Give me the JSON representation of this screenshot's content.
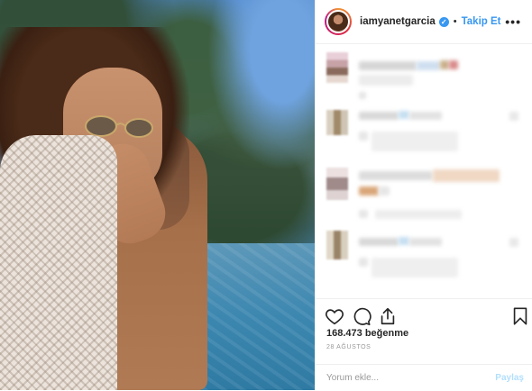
{
  "header": {
    "username": "iamyanetgarcia",
    "verified_icon": "verified-badge-icon",
    "separator": "•",
    "follow_label": "Takip Et",
    "more_icon": "more-options-icon",
    "more_glyph": "•••"
  },
  "actions": {
    "like_icon": "heart-icon",
    "comment_icon": "comment-bubble-icon",
    "share_icon": "share-icon",
    "save_icon": "bookmark-icon",
    "likes_text": "168.473 beğenme",
    "date_text": "28 AĞUSTOS"
  },
  "comment_box": {
    "placeholder": "Yorum ekle...",
    "post_label": "Paylaş"
  },
  "colors": {
    "accent": "#3897f0",
    "text": "#262626",
    "muted": "#999999",
    "border": "#efefef"
  }
}
